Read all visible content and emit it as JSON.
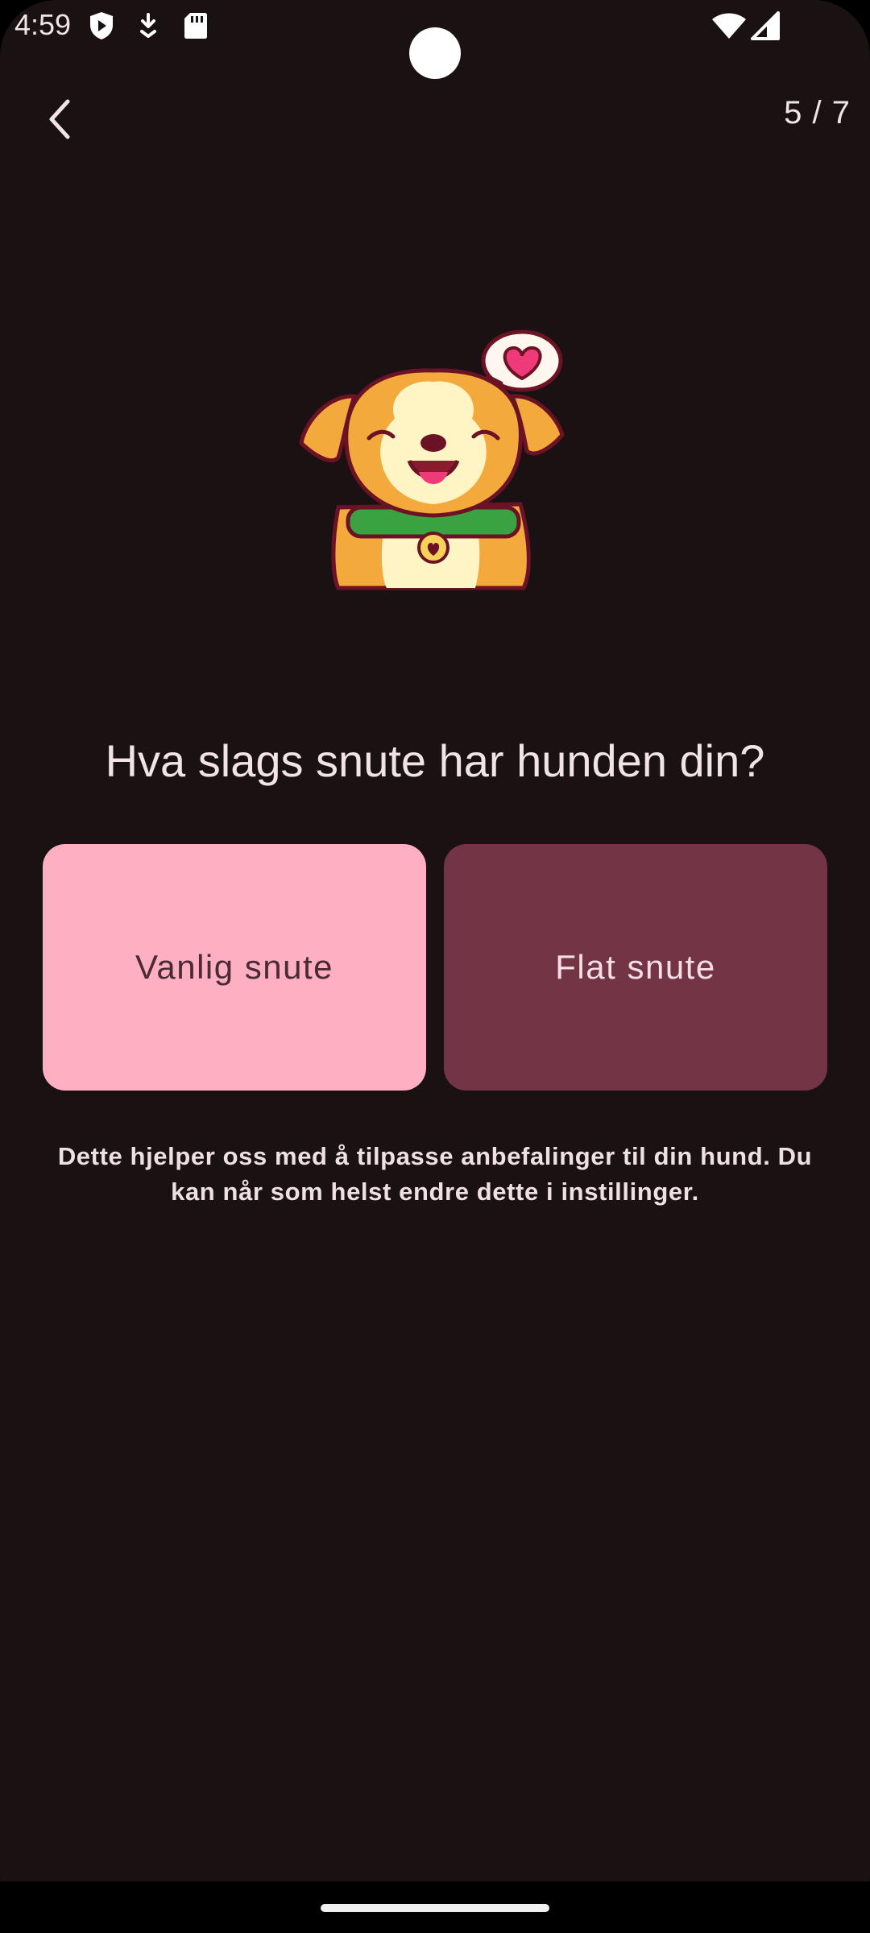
{
  "status_bar": {
    "time": "4:59",
    "icons": [
      "shield-play-icon",
      "download-icon",
      "sd-card-icon",
      "wifi-icon",
      "signal-icon"
    ]
  },
  "header": {
    "back_icon": "chevron-left-icon",
    "step_counter": "5 / 7"
  },
  "illustration": {
    "name": "dog-with-heart-illustration"
  },
  "question": {
    "title": "Hva slags snute har hunden din?"
  },
  "options": [
    {
      "label": "Vanlig snute",
      "selected": true,
      "color": "#ffafc2"
    },
    {
      "label": "Flat snute",
      "selected": false,
      "color": "#733446"
    }
  ],
  "hint": {
    "text": "Dette hjelper oss med å tilpasse anbefalinger til din hund. Du kan når som helst endre dette i instillinger."
  },
  "colors": {
    "background": "#1a1113",
    "text": "#f2e4e6",
    "accent": "#ffafc2"
  }
}
